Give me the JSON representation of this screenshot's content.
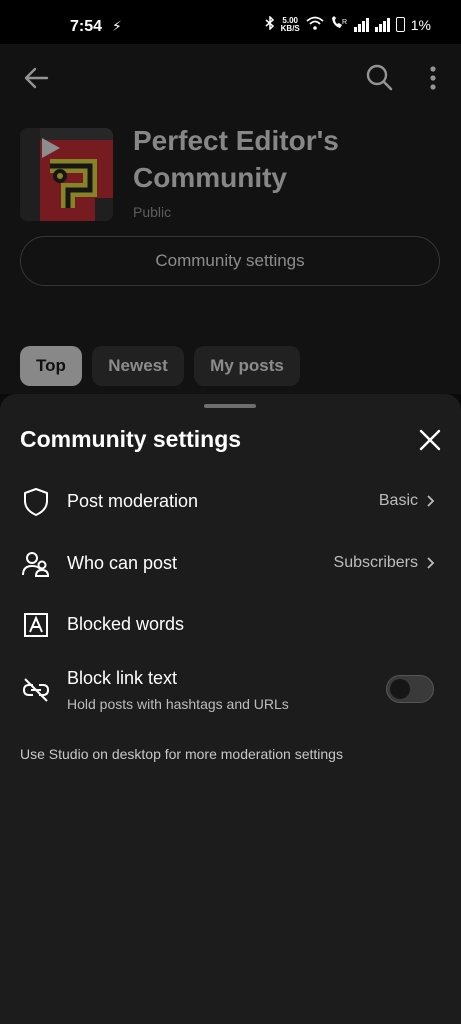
{
  "status_bar": {
    "time": "7:54",
    "speed_value": "5.00",
    "speed_unit": "KB/S",
    "battery": "1%"
  },
  "header": {
    "back_icon": "arrow-left-icon",
    "search_icon": "search-icon",
    "more_icon": "more-vertical-icon"
  },
  "community": {
    "name": "Perfect Editor's Community",
    "visibility": "Public",
    "settings_button": "Community settings"
  },
  "feed_tabs": [
    "Top",
    "Newest",
    "My posts"
  ],
  "selected_tab": "Top",
  "sheet": {
    "title": "Community settings",
    "rows": [
      {
        "icon": "shield-icon",
        "label": "Post moderation",
        "value": "Basic"
      },
      {
        "icon": "people-icon",
        "label": "Who can post",
        "value": "Subscribers"
      },
      {
        "icon": "text-box-icon",
        "label": "Blocked words"
      },
      {
        "icon": "link-off-icon",
        "label": "Block link text",
        "sublabel": "Hold posts with hashtags and URLs",
        "toggle_on": false
      }
    ],
    "footnote": "Use Studio on desktop for more moderation settings"
  },
  "colors": {
    "sheet_bg": "#1c1c1c",
    "page_bg": "#121212",
    "selected_chip": "#e9e9e9",
    "chip_bg": "#2e2e2e"
  }
}
